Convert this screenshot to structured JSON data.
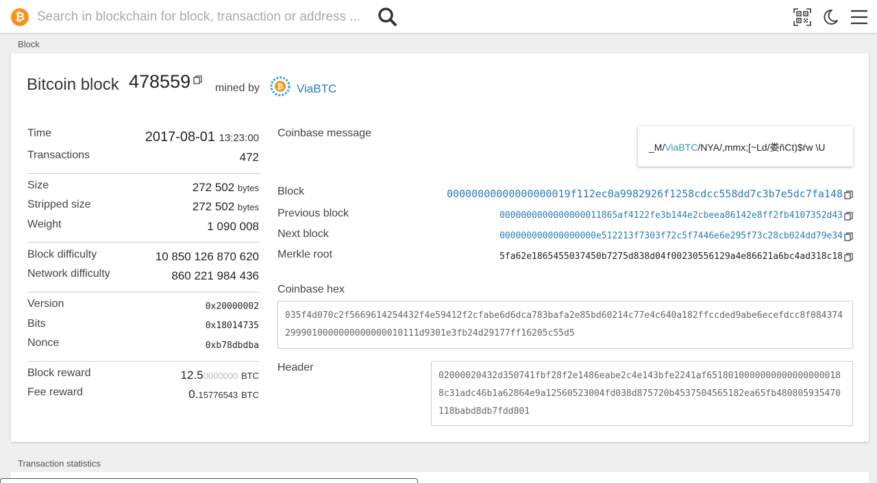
{
  "search": {
    "placeholder": "Search in blockchain for block, transaction or address ..."
  },
  "icons": {
    "logo": "bitcoin-logo",
    "search": "search-icon",
    "qr": "qr-scan-icon",
    "theme": "moon-icon",
    "menu": "hamburger-menu-icon",
    "copy": "copy-icon"
  },
  "colors": {
    "accent": "#f7931a",
    "link": "#2a7bb5",
    "pool": "#2a9d9d"
  },
  "breadcrumb": "Block",
  "block": {
    "title": "Bitcoin block",
    "height": "478559",
    "mined_by_label": "mined by",
    "pool": "ViaBTC",
    "time_label": "Time",
    "time_date": "2017-08-01",
    "time_clock": "13:23:00",
    "transactions_label": "Transactions",
    "transactions": "472",
    "size_label": "Size",
    "size": "272 502",
    "stripped_size_label": "Stripped size",
    "stripped_size": "272 502",
    "bytes_unit": "bytes",
    "weight_label": "Weight",
    "weight": "1 090 008",
    "block_difficulty_label": "Block difficulty",
    "block_difficulty": "10 850 126 870 620",
    "network_difficulty_label": "Network difficulty",
    "network_difficulty": "860 221 984 436",
    "version_label": "Version",
    "version": "0x20000002",
    "bits_label": "Bits",
    "bits": "0x18014735",
    "nonce_label": "Nonce",
    "nonce": "0xb78dbdba",
    "block_reward_label": "Block reward",
    "block_reward_main": "12.5",
    "block_reward_dim": "0000000",
    "fee_reward_label": "Fee reward",
    "fee_reward_main": "0.",
    "fee_reward_small": "15776543",
    "btc_unit": "BTC",
    "coinbase_message_label": "Coinbase message",
    "coinbase_message_prefix": "_M/",
    "coinbase_message_pool": "ViaBTC",
    "coinbase_message_suffix": "/NYA/,mmx;[~Ld/娄ňCt)$ŕw \\U",
    "block_hash_label": "Block",
    "block_hash": "00000000000000000019f112ec0a9982926f1258cdcc558dd7c3b7e5dc7fa148",
    "prev_block_label": "Previous block",
    "prev_block": "0000000000000000011865af4122fe3b144e2cbeea86142e8ff2fb4107352d43",
    "next_block_label": "Next block",
    "next_block": "000000000000000000e512213f7303f72c5f7446e6e295f73c28cb024dd79e34",
    "merkle_root_label": "Merkle root",
    "merkle_root": "5fa62e1865455037450b7275d838d04f00230556129a4e86621a6bc4ad318c18",
    "coinbase_hex_label": "Coinbase hex",
    "coinbase_hex": "035f4d070c2f5669614254432f4e59412f2cfabe6d6dca783bafa2e85bd60214c77e4c640a182ffccded9abe6ecefdcc8f0843742999010000000000000010111d9301e3fb24d29177ff16205c55d5",
    "header_label": "Header",
    "header": "02000020432d350741fbf28f2e1486eabe2c4e143bfe2241af65180100000000000000000188c31adc46b1a62864e9a12560523004fd038d875720b4537504565182ea65fb480805935470118babd8db7fdd801"
  },
  "transaction_statistics_label": "Transaction statistics"
}
